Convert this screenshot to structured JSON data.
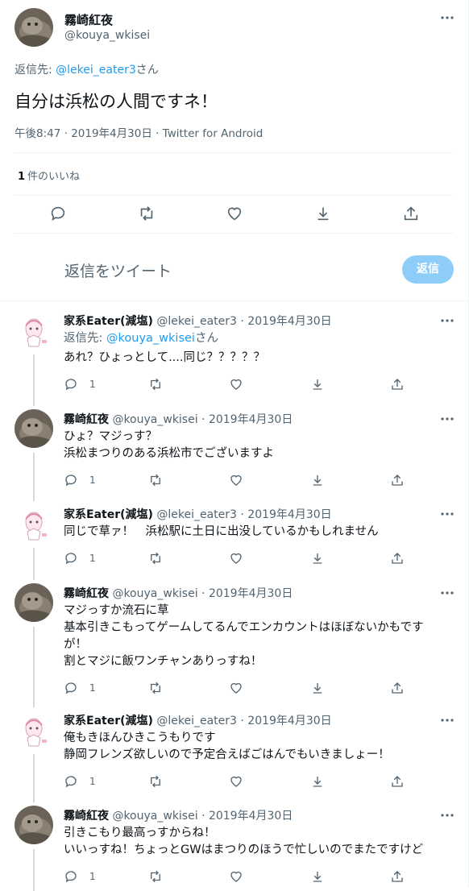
{
  "main_tweet": {
    "name": "霧崎紅夜",
    "handle": "@kouya_wkisei",
    "reply_to_prefix": "返信先: ",
    "reply_to_handle": "@lekei_eater3",
    "reply_to_suffix": "さん",
    "text": "自分は浜松の人間ですネ！",
    "timestamp": "午後8:47 · 2019年4月30日 · Twitter for Android",
    "likes_count": "1",
    "likes_label": "件のいいね",
    "compose_placeholder": "返信をツイート",
    "reply_button": "返信"
  },
  "replies": [
    {
      "avatar": "character",
      "name": "家系Eater(減塩)",
      "handle": "@lekei_eater3",
      "date": "· 2019年4月30日",
      "reply_to": {
        "prefix": "返信先: ",
        "handle": "@kouya_wkisei",
        "suffix": "さん"
      },
      "lines": [
        "あれ？ひょっとして....同じ？？？？？"
      ],
      "reply_count": "1"
    },
    {
      "avatar": "cat",
      "name": "霧崎紅夜",
      "handle": "@kouya_wkisei",
      "date": "· 2019年4月30日",
      "lines": [
        "ひょ？マジっす？",
        "浜松まつりのある浜松市でございますよ"
      ],
      "reply_count": "1"
    },
    {
      "avatar": "character",
      "name": "家系Eater(減塩)",
      "handle": "@lekei_eater3",
      "date": "· 2019年4月30日",
      "lines": [
        "同じで草ァ！　浜松駅に土日に出没しているかもしれません"
      ],
      "reply_count": "1"
    },
    {
      "avatar": "cat",
      "name": "霧崎紅夜",
      "handle": "@kouya_wkisei",
      "date": "· 2019年4月30日",
      "lines": [
        "マジっすか流石に草",
        "基本引きこもってゲームしてるんでエンカウントはほぼないかもです",
        "が！",
        "割とマジに飯ワンチャンありっすね！"
      ],
      "reply_count": "1"
    },
    {
      "avatar": "character",
      "name": "家系Eater(減塩)",
      "handle": "@lekei_eater3",
      "date": "· 2019年4月30日",
      "lines": [
        "俺もきほんひきこうもりです",
        "静岡フレンズ欲しいので予定合えばごはんでもいきましょー！"
      ],
      "reply_count": "1"
    },
    {
      "avatar": "cat",
      "name": "霧崎紅夜",
      "handle": "@kouya_wkisei",
      "date": "· 2019年4月30日",
      "lines": [
        "引きこもり最高っすからね！",
        "いいっすね！ちょっとGWはまつりのほうで忙しいのでまたですけど"
      ],
      "reply_count": "1"
    }
  ],
  "colors": {
    "accent": "#1d9bf0",
    "muted": "#536471",
    "text": "#0f1419",
    "reply_button_bg": "#8ecdf8"
  }
}
